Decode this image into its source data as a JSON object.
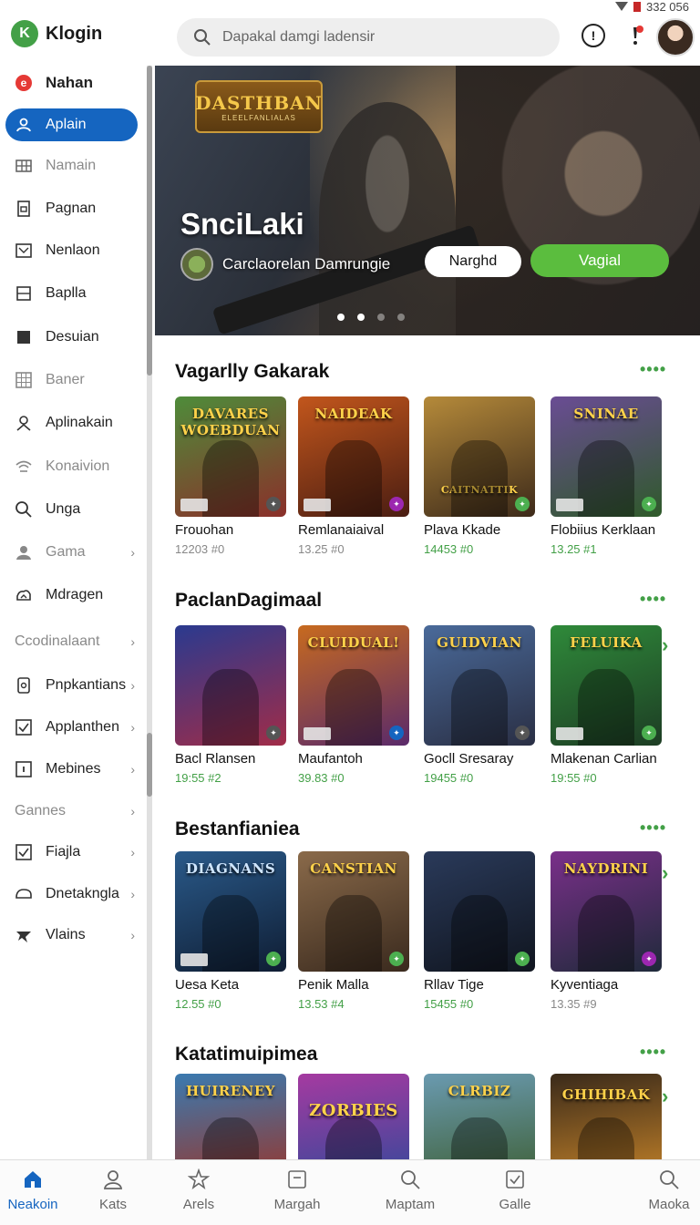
{
  "status": {
    "time": "332 056"
  },
  "app": {
    "name": "Klogin",
    "logo": "K"
  },
  "search": {
    "placeholder": "Dapakal damgi ladensir"
  },
  "sidebar": {
    "items": [
      {
        "label": "Nahan",
        "icon": "e-icon"
      },
      {
        "label": "Aplain",
        "icon": "users-icon"
      },
      {
        "label": "Namain",
        "icon": "grid-icon"
      },
      {
        "label": "Pagnan",
        "icon": "doc-icon"
      },
      {
        "label": "Nenlaon",
        "icon": "image-icon"
      },
      {
        "label": "Baplla",
        "icon": "list-icon"
      },
      {
        "label": "Desuian",
        "icon": "square-icon"
      },
      {
        "label": "Baner",
        "icon": "grid-icon"
      },
      {
        "label": "Aplinakain",
        "icon": "user-icon"
      },
      {
        "label": "Konaivion",
        "icon": "wifi-icon"
      },
      {
        "label": "Unga",
        "icon": "search-icon"
      },
      {
        "label": "Gama",
        "icon": "person-icon"
      },
      {
        "label": "Mdragen",
        "icon": "cloud-icon"
      },
      {
        "label": "Ccodinalaant"
      },
      {
        "label": "Pnpkantians",
        "icon": "sq-icon"
      },
      {
        "label": "Applanthen",
        "icon": "check-icon"
      },
      {
        "label": "Mebines",
        "icon": "box-icon"
      },
      {
        "label": "Gannes"
      },
      {
        "label": "Fiajla",
        "icon": "check-icon"
      },
      {
        "label": "Dnetakngla",
        "icon": "chat-icon"
      },
      {
        "label": "Vlains",
        "icon": "star-icon"
      }
    ]
  },
  "hero": {
    "logo_title": "DASTHBAN",
    "logo_sub": "ELEELFANLIALAS",
    "title": "SnciLaki",
    "subtitle": "Carclaorelan Damrungie",
    "secondary_button": "Narghd",
    "primary_button": "Vagial"
  },
  "sections": [
    {
      "title": "Vagarlly Gakarak",
      "more": "••••",
      "cards": [
        {
          "thumb_text": "DAVARES WOEBDUAN",
          "name": "Frouohan",
          "stat": "12203 #0",
          "green": false,
          "c1": "#4e8c3a",
          "c2": "#8b2f2a"
        },
        {
          "thumb_text": "NAIDEAK",
          "name": "Remlanaiaival",
          "stat": "13.25 #0",
          "green": false,
          "c1": "#c2561c",
          "c2": "#4a1d12"
        },
        {
          "thumb_text": "CAITNATTIK",
          "name": "Plava Kkade",
          "stat": "14453 #0",
          "green": true,
          "c1": "#b58a3a",
          "c2": "#3d2a1a"
        },
        {
          "thumb_text": "SNINAE",
          "name": "Flobiius Kerklaan",
          "stat": "13.25 #1",
          "green": true,
          "c1": "#6a4c94",
          "c2": "#2f5a2a"
        }
      ]
    },
    {
      "title": "PaclanDagimaal",
      "more": "••••",
      "cards": [
        {
          "thumb_text": "",
          "name": "Bacl Rlansen",
          "stat": "19:55 #2",
          "green": true,
          "c1": "#2a3a8f",
          "c2": "#a12c48"
        },
        {
          "thumb_text": "CLUIDUAL!",
          "name": "Maufantoh",
          "stat": "39.83 #0",
          "green": true,
          "c1": "#c76a1f",
          "c2": "#5a2a6a"
        },
        {
          "thumb_text": "GUIDVIAN",
          "name": "Gocll Sresaray",
          "stat": "19455 #0",
          "green": true,
          "c1": "#4a6a9a",
          "c2": "#2a2f44"
        },
        {
          "thumb_text": "FELUIKA",
          "name": "Mlakenan Carlian",
          "stat": "19:55 #0",
          "green": true,
          "c1": "#2f8a3a",
          "c2": "#1d3d24"
        }
      ]
    },
    {
      "title": "Bestanfianiea",
      "more": "••••",
      "cards": [
        {
          "thumb_text": "DIAGNANS",
          "name": "Uesa Keta",
          "stat": "12.55 #0",
          "green": true,
          "c1": "#2a5a8a",
          "c2": "#0f1d33"
        },
        {
          "thumb_text": "CANSTIAN",
          "name": "Penik Malla",
          "stat": "13.53 #4",
          "green": true,
          "c1": "#8a6a4a",
          "c2": "#3a2a1e"
        },
        {
          "thumb_text": "",
          "name": "Rllav Tige",
          "stat": "15455 #0",
          "green": true,
          "c1": "#2a3a5a",
          "c2": "#10151f"
        },
        {
          "thumb_text": "NAYDRINI",
          "name": "Kyventiaga",
          "stat": "13.35 #9",
          "green": false,
          "c1": "#7a2f8a",
          "c2": "#1f2a3a"
        }
      ]
    },
    {
      "title": "Katatimuipimea",
      "more": "••••",
      "cards": [
        {
          "thumb_text": "HUIRENEY",
          "name": "",
          "stat": "",
          "green": false,
          "c1": "#3a7ab0",
          "c2": "#a03020"
        },
        {
          "thumb_text": "ZORBIES",
          "name": "",
          "stat": "",
          "green": false,
          "c1": "#a53aa0",
          "c2": "#2a4a9a"
        },
        {
          "thumb_text": "CLRBIZ",
          "name": "",
          "stat": "",
          "green": false,
          "c1": "#6a9ab0",
          "c2": "#3a5a2a"
        },
        {
          "thumb_text": "GHIHIBAK",
          "name": "",
          "stat": "",
          "green": false,
          "c1": "#d08a2a",
          "c2": "#3a2a1a"
        }
      ]
    }
  ],
  "bottom_nav": [
    {
      "label": "Neakoin",
      "icon": "home-icon",
      "active": true
    },
    {
      "label": "Kats",
      "icon": "person-icon",
      "active": false
    },
    {
      "label": "Arels",
      "icon": "star-icon",
      "active": false
    },
    {
      "label": "Margah",
      "icon": "box-icon",
      "active": false
    },
    {
      "label": "Maptam",
      "icon": "search-icon",
      "active": false
    },
    {
      "label": "Galle",
      "icon": "check-icon",
      "active": false
    },
    {
      "label": "Maoka",
      "icon": "search-icon",
      "active": false
    }
  ],
  "colors": {
    "accent": "#1565c0",
    "green": "#43a047",
    "primary_button": "#5bbd3e"
  }
}
